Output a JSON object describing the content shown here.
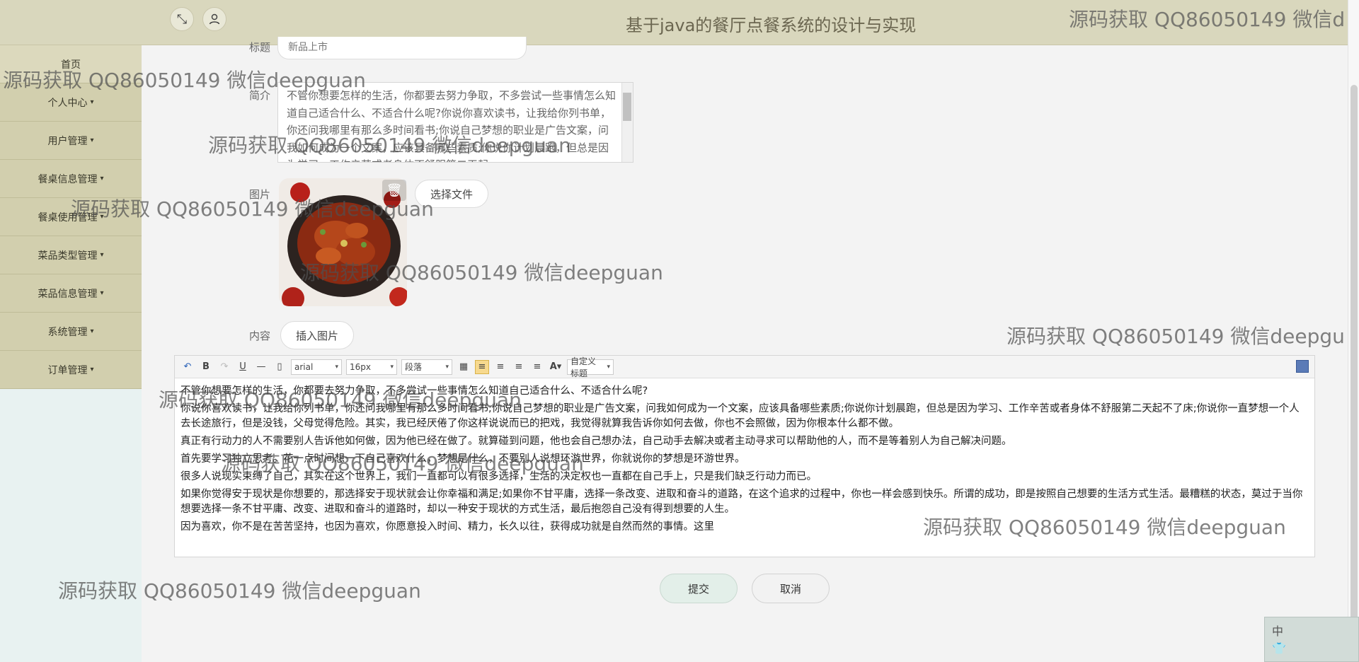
{
  "header": {
    "title": "基于java的餐厅点餐系统的设计与实现"
  },
  "sidebar": {
    "items": [
      {
        "label": "首页",
        "has_dropdown": false
      },
      {
        "label": "个人中心",
        "has_dropdown": true
      },
      {
        "label": "用户管理",
        "has_dropdown": true
      },
      {
        "label": "餐桌信息管理",
        "has_dropdown": true
      },
      {
        "label": "餐桌使用管理",
        "has_dropdown": true
      },
      {
        "label": "菜品类型管理",
        "has_dropdown": true
      },
      {
        "label": "菜品信息管理",
        "has_dropdown": true
      },
      {
        "label": "系统管理",
        "has_dropdown": true
      },
      {
        "label": "订单管理",
        "has_dropdown": true
      }
    ],
    "caret": "▾"
  },
  "form": {
    "title_label": "标题",
    "title_value": "新品上市",
    "desc_label": "简介",
    "desc_value": "不管你想要怎样的生活，你都要去努力争取，不多尝试一些事情怎么知道自己适合什么、不适合什么呢?你说你喜欢读书，让我给你列书单，你还问我哪里有那么多时间看书;你说自己梦想的职业是广告文案，问我如何成为一个文案，应该具备哪些素质;你说你计划晨跑，但总是因为学习、工作辛苦或者身体不舒服第二天起",
    "image_label": "图片",
    "choose_file_label": "选择文件",
    "content_label": "内容",
    "insert_image_label": "插入图片",
    "submit_label": "提交",
    "cancel_label": "取消"
  },
  "editor": {
    "font_family": "arial",
    "font_size": "16px",
    "paragraph": "段落",
    "custom_title": "自定义标题",
    "paragraphs": [
      "不管你想要怎样的生活，你都要去努力争取，不多尝试一些事情怎么知道自己适合什么、不适合什么呢?",
      "你说你喜欢读书，让我给你列书单，你还问我哪里有那么多时间看书;你说自己梦想的职业是广告文案，问我如何成为一个文案，应该具备哪些素质;你说你计划晨跑，但总是因为学习、工作辛苦或者身体不舒服第二天起不了床;你说你一直梦想一个人去长途旅行，但是没钱，父母觉得危险。其实，我已经厌倦了你这样说说而已的把戏，我觉得就算我告诉你如何去做，你也不会照做，因为你根本什么都不做。",
      "真正有行动力的人不需要别人告诉他如何做，因为他已经在做了。就算碰到问题，他也会自己想办法，自己动手去解决或者主动寻求可以帮助他的人，而不是等着别人为自己解决问题。",
      "首先要学习独立思考。花一点时间想一下自己喜欢什么，梦想是什么，不要别人说想环游世界，你就说你的梦想是环游世界。",
      "很多人说现实束缚了自己，其实在这个世界上，我们一直都可以有很多选择，生活的决定权也一直都在自己手上，只是我们缺乏行动力而已。",
      "如果你觉得安于现状是你想要的，那选择安于现状就会让你幸福和满足;如果你不甘平庸，选择一条改变、进取和奋斗的道路，在这个追求的过程中，你也一样会感到快乐。所谓的成功，即是按照自己想要的生活方式生活。最糟糕的状态，莫过于当你想要选择一条不甘平庸、改变、进取和奋斗的道路时，却以一种安于现状的方式生活，最后抱怨自己没有得到想要的人生。",
      "因为喜欢，你不是在苦苦坚持，也因为喜欢，你愿意投入时间、精力，长久以往，获得成功就是自然而然的事情。这里"
    ]
  },
  "watermark": "源码获取 QQ86050149 微信deepguan",
  "watermark_top": "源码获取 QQ86050149 微信d",
  "watermark_right": "源码获取 QQ86050149 微信deepgu",
  "widget": {
    "zh_label": "中"
  },
  "icons": [
    "fullscreen-icon",
    "user-icon",
    "trash-icon",
    "undo-icon",
    "redo-icon"
  ],
  "colors": {
    "topbar": "#d9d7bd",
    "menu": "#d2cfae",
    "sidebar_bg": "#e8f2f1",
    "submit_bg": "#e3efe9"
  }
}
